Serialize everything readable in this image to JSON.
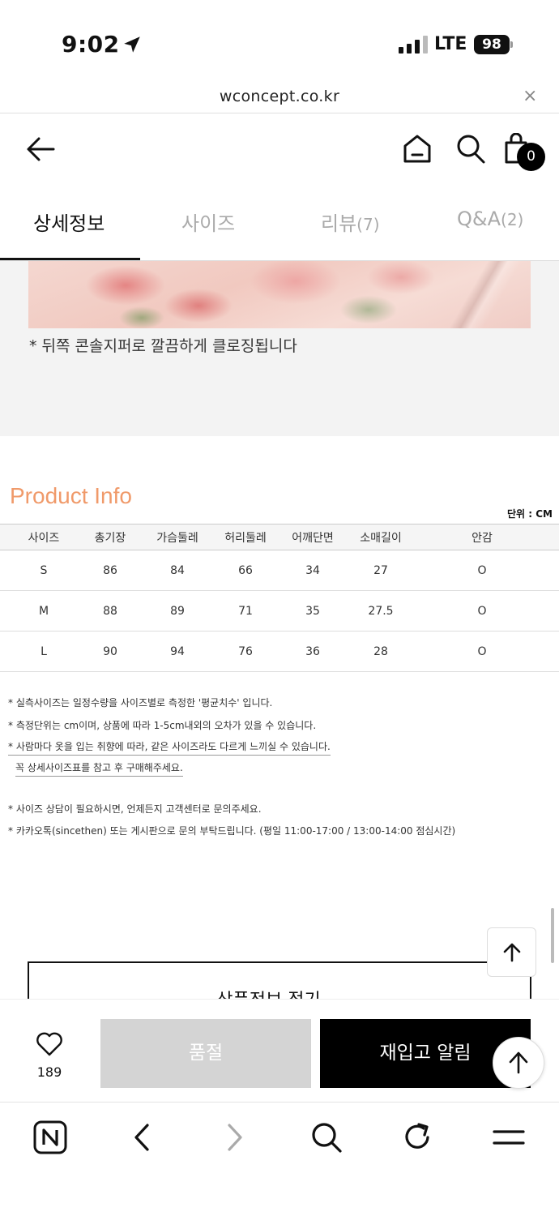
{
  "status_bar": {
    "time": "9:02",
    "network": "LTE",
    "battery": "98"
  },
  "browser": {
    "url": "wconcept.co.kr",
    "close_symbol": "×"
  },
  "header": {
    "cart_count": "0",
    "icons": [
      "back-arrow-icon",
      "home-icon",
      "search-icon",
      "shopping-bag-icon"
    ]
  },
  "tabs": [
    {
      "label": "상세정보",
      "count": ""
    },
    {
      "label": "사이즈",
      "count": ""
    },
    {
      "label": "리뷰",
      "count": "(7)"
    },
    {
      "label": "Q&A",
      "count": "(2)"
    }
  ],
  "detail": {
    "closing_note": "* 뒤쪽 콘솔지퍼로 깔끔하게 클로징됩니다"
  },
  "product_info": {
    "title": "Product Info",
    "unit": "단위 : CM",
    "headers": [
      "사이즈",
      "총기장",
      "가슴둘레",
      "허리둘레",
      "어깨단면",
      "소매길이",
      "안감"
    ],
    "rows": [
      [
        "S",
        "86",
        "84",
        "66",
        "34",
        "27",
        "O"
      ],
      [
        "M",
        "88",
        "89",
        "71",
        "35",
        "27.5",
        "O"
      ],
      [
        "L",
        "90",
        "94",
        "76",
        "36",
        "28",
        "O"
      ]
    ],
    "notes": [
      "* 실측사이즈는 일정수량을 사이즈별로 측정한 '평균치수' 입니다.",
      "* 측정단위는 cm이며, 상품에 따라 1-5cm내외의 오차가 있을 수 있습니다.",
      "* 사람마다 옷을 입는 취향에 따라, 같은 사이즈라도 다르게 느끼실 수 있습니다.",
      "꼭 상세사이즈표를 참고 후 구매해주세요.",
      "* 사이즈 상담이 필요하시면, 언제든지 고객센터로 문의주세요.",
      "* 카카오톡(sincethen) 또는 게시판으로 문의 부탁드립니다. (평일 11:00-17:00 / 13:00-14:00 점심시간)"
    ]
  },
  "collapse_button": {
    "label": "상품정보 접기"
  },
  "purchase_bar": {
    "like_count": "189",
    "soldout_label": "품절",
    "restock_label": "재입고 알림"
  },
  "browser_nav": {
    "icons": [
      "naver-n-icon",
      "back-chevron-icon",
      "forward-chevron-icon",
      "search-icon",
      "refresh-icon",
      "menu-icon"
    ]
  }
}
